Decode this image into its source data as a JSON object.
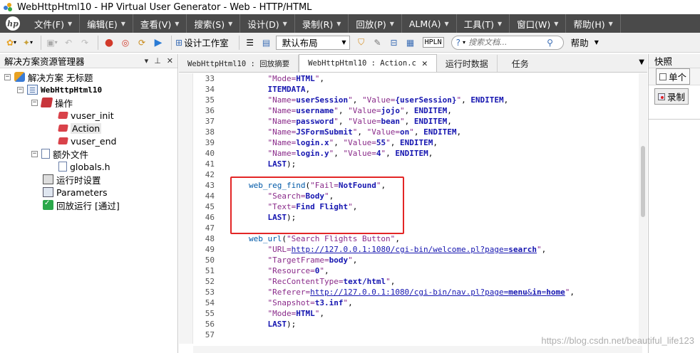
{
  "window": {
    "title": "WebHttpHtml10 - HP Virtual User Generator - Web - HTTP/HTML"
  },
  "menu": {
    "logo": "hp",
    "items": [
      "文件(F)",
      "编辑(E)",
      "查看(V)",
      "搜索(S)",
      "设计(D)",
      "录制(R)",
      "回放(P)",
      "ALM(A)",
      "工具(T)",
      "窗口(W)",
      "帮助(H)"
    ]
  },
  "toolbar": {
    "design_studio": "设计工作室",
    "layout_value": "默认布局",
    "hpln": "HPLN",
    "search_placeholder": "搜索文档...",
    "help_label": "帮助"
  },
  "solution_explorer": {
    "title": "解决方案资源管理器",
    "tree": {
      "root": "解决方案 无标题",
      "script": "WebHttpHtml10",
      "actions_group": "操作",
      "actions": [
        "vuser_init",
        "Action",
        "vuser_end"
      ],
      "extra_files": "额外文件",
      "files": [
        "globals.h"
      ],
      "runtime_settings": "运行时设置",
      "parameters": "Parameters",
      "replay_run": "回放运行 [通过]"
    }
  },
  "editor": {
    "tabs": [
      {
        "label": "WebHttpHtml10 : 回放摘要"
      },
      {
        "label": "WebHttpHtml10 : Action.c"
      },
      {
        "label": "运行时数据"
      },
      {
        "label": "任务"
      }
    ],
    "code_lines": [
      {
        "n": "33",
        "text": "\"Mode=HTML\","
      },
      {
        "n": "34",
        "text": "ITEMDATA,"
      },
      {
        "n": "35",
        "text": "\"Name=userSession\", \"Value={userSession}\", ENDITEM,"
      },
      {
        "n": "36",
        "text": "\"Name=username\", \"Value=jojo\", ENDITEM,"
      },
      {
        "n": "37",
        "text": "\"Name=password\", \"Value=bean\", ENDITEM,"
      },
      {
        "n": "38",
        "text": "\"Name=JSFormSubmit\", \"Value=on\", ENDITEM,"
      },
      {
        "n": "39",
        "text": "\"Name=login.x\", \"Value=55\", ENDITEM,"
      },
      {
        "n": "40",
        "text": "\"Name=login.y\", \"Value=4\", ENDITEM,"
      },
      {
        "n": "41",
        "text": "LAST);"
      },
      {
        "n": "42",
        "text": ""
      },
      {
        "n": "43",
        "text": "web_reg_find(\"Fail=NotFound\","
      },
      {
        "n": "44",
        "text": "\"Search=Body\","
      },
      {
        "n": "45",
        "text": "\"Text=Find Flight\","
      },
      {
        "n": "46",
        "text": "LAST);"
      },
      {
        "n": "47",
        "text": ""
      },
      {
        "n": "48",
        "text": "web_url(\"Search Flights Button\","
      },
      {
        "n": "49",
        "text": "\"URL=http://127.0.0.1:1080/cgi-bin/welcome.pl?page=search\","
      },
      {
        "n": "50",
        "text": "\"TargetFrame=body\","
      },
      {
        "n": "51",
        "text": "\"Resource=0\","
      },
      {
        "n": "52",
        "text": "\"RecContentType=text/html\","
      },
      {
        "n": "53",
        "text": "\"Referer=http://127.0.0.1:1080/cgi-bin/nav.pl?page=menu&in=home\","
      },
      {
        "n": "54",
        "text": "\"Snapshot=t3.inf\","
      },
      {
        "n": "55",
        "text": "\"Mode=HTML\","
      },
      {
        "n": "56",
        "text": "LAST);"
      },
      {
        "n": "57",
        "text": ""
      }
    ]
  },
  "snapshot_panel": {
    "title": "快照",
    "single_label": "单个",
    "record_label": "录制"
  },
  "watermark": "https://blog.csdn.net/beautiful_life123"
}
